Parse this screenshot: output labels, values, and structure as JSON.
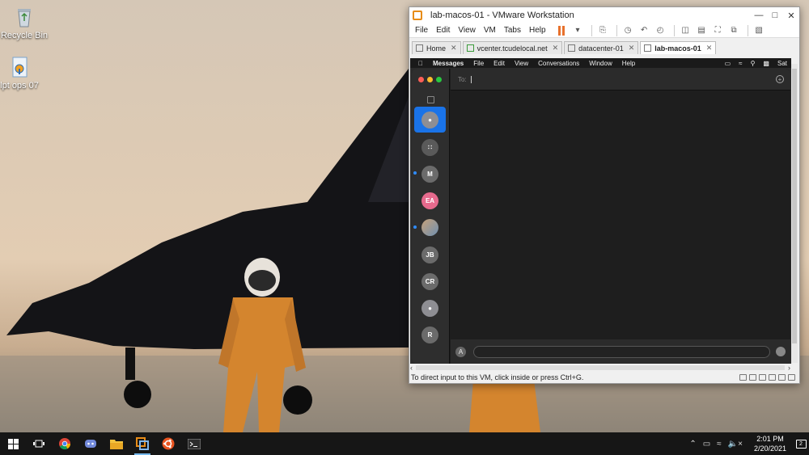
{
  "desktop": {
    "icons": [
      {
        "label": "Recycle Bin",
        "icon": "recycle-bin-icon"
      },
      {
        "label": "lpt ops 07",
        "icon": "key-file-icon"
      }
    ]
  },
  "vmware": {
    "title": "lab-macos-01 - VMware Workstation",
    "menu": [
      "File",
      "Edit",
      "View",
      "VM",
      "Tabs",
      "Help"
    ],
    "tabs": [
      {
        "label": "Home",
        "icon": "home-icon",
        "active": false
      },
      {
        "label": "vcenter.tcudelocal.net",
        "icon": "vcenter-icon",
        "active": false
      },
      {
        "label": "datacenter-01",
        "icon": "datacenter-icon",
        "active": false
      },
      {
        "label": "lab-macos-01",
        "icon": "vm-icon",
        "active": true
      }
    ],
    "status_text": "To direct input to this VM, click inside or press Ctrl+G.",
    "accent": "#e8712c"
  },
  "mac": {
    "menubar": {
      "app": "Messages",
      "items": [
        "File",
        "Edit",
        "View",
        "Conversations",
        "Window",
        "Help"
      ],
      "clock": "Sat"
    },
    "messages": {
      "to_label": "To:",
      "conversations": [
        {
          "initials": "",
          "color": "#8e8e93",
          "selected": true,
          "unread": false,
          "icon": "person-icon"
        },
        {
          "initials": "",
          "color": "#5a5a5a",
          "selected": false,
          "unread": false,
          "icon": "group-icon"
        },
        {
          "initials": "M",
          "color": "#6b6b6b",
          "selected": false,
          "unread": true,
          "icon": ""
        },
        {
          "initials": "EA",
          "color": "#e66a8d",
          "selected": false,
          "unread": false,
          "icon": ""
        },
        {
          "initials": "",
          "color": "#b08a6a",
          "selected": false,
          "unread": true,
          "icon": "photo-avatar-icon"
        },
        {
          "initials": "JB",
          "color": "#6b6b6b",
          "selected": false,
          "unread": false,
          "icon": ""
        },
        {
          "initials": "CR",
          "color": "#6b6b6b",
          "selected": false,
          "unread": false,
          "icon": ""
        },
        {
          "initials": "",
          "color": "#8e8e93",
          "selected": false,
          "unread": false,
          "icon": "person-icon"
        },
        {
          "initials": "R",
          "color": "#6b6b6b",
          "selected": false,
          "unread": false,
          "icon": ""
        }
      ]
    }
  },
  "taskbar": {
    "apps": [
      "start-icon",
      "task-view-icon",
      "chrome-icon",
      "discord-icon",
      "file-explorer-icon",
      "vmware-icon",
      "ubuntu-icon",
      "terminal-icon"
    ],
    "time": "2:01 PM",
    "date": "2/20/2021",
    "notifications": "2"
  }
}
